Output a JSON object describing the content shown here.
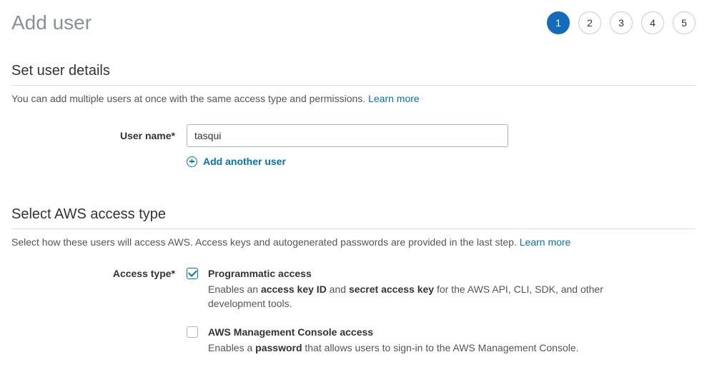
{
  "header": {
    "title": "Add user",
    "steps": [
      "1",
      "2",
      "3",
      "4",
      "5"
    ],
    "active_step": 0
  },
  "user_details": {
    "section_title": "Set user details",
    "desc_prefix": "You can add multiple users at once with the same access type and permissions. ",
    "learn_more": "Learn more",
    "username_label": "User name*",
    "username_value": "tasqui",
    "add_another": "Add another user"
  },
  "access": {
    "section_title": "Select AWS access type",
    "desc_prefix": "Select how these users will access AWS. Access keys and autogenerated passwords are provided in the last step. ",
    "learn_more": "Learn more",
    "label": "Access type*",
    "prog": {
      "title": "Programmatic access",
      "desc_1": "Enables an ",
      "bold_1": "access key ID",
      "desc_2": " and ",
      "bold_2": "secret access key",
      "desc_3": " for the AWS API, CLI, SDK, and other development tools.",
      "checked": true
    },
    "console": {
      "title": "AWS Management Console access",
      "desc_1": "Enables a ",
      "bold_1": "password",
      "desc_2": " that allows users to sign-in to the AWS Management Console.",
      "checked": false
    }
  }
}
